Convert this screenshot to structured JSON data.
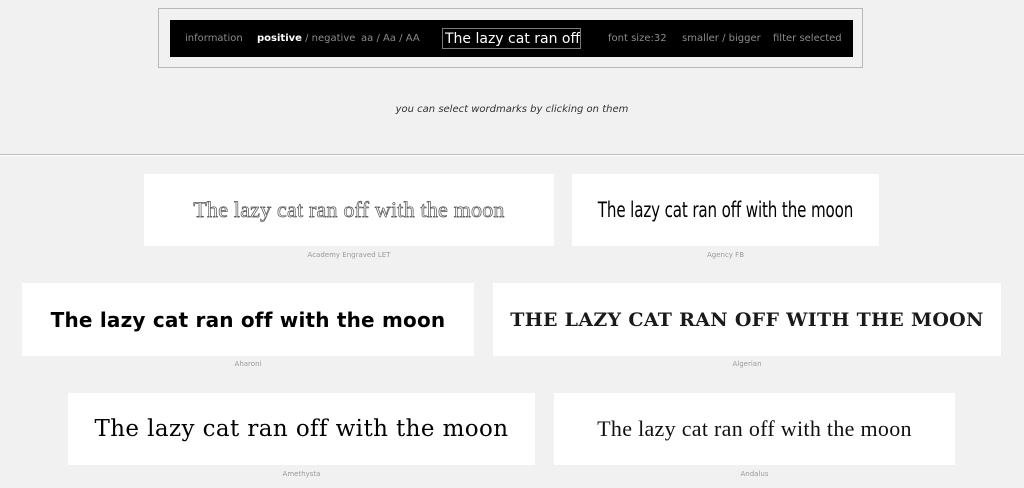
{
  "toolbar": {
    "information": "information",
    "positive": "positive",
    "slash": "/",
    "negative": "negative",
    "case_lower": "aa",
    "case_title": "Aa",
    "case_upper": "AA",
    "sample_text": "The lazy cat ran off",
    "font_size_label": "font size:",
    "font_size_value": "32",
    "smaller": "smaller",
    "bigger": "bigger",
    "filter_selected": "filter selected"
  },
  "hint": "you can select wordmarks by clicking on them",
  "wordmarks": [
    {
      "text": "The lazy cat ran off with the moon",
      "font": "Academy Engraved LET"
    },
    {
      "text": "The lazy cat ran off with the moon",
      "font": "Agency FB"
    },
    {
      "text": "The lazy cat ran off with the moon",
      "font": "Aharoni"
    },
    {
      "text": "The lazy cat ran off with the moon",
      "font": "Algerian"
    },
    {
      "text": "The lazy cat ran off with the moon",
      "font": "Amethysta"
    },
    {
      "text": "The lazy cat ran off with the moon",
      "font": "Andalus"
    }
  ],
  "colors": {
    "background": "#f1f1f1",
    "toolbar_bg": "#000000",
    "toolbar_text": "#8c8c8c",
    "toolbar_active": "#ffffff",
    "card_bg": "#ffffff",
    "caption_text": "#9a9a9a"
  }
}
